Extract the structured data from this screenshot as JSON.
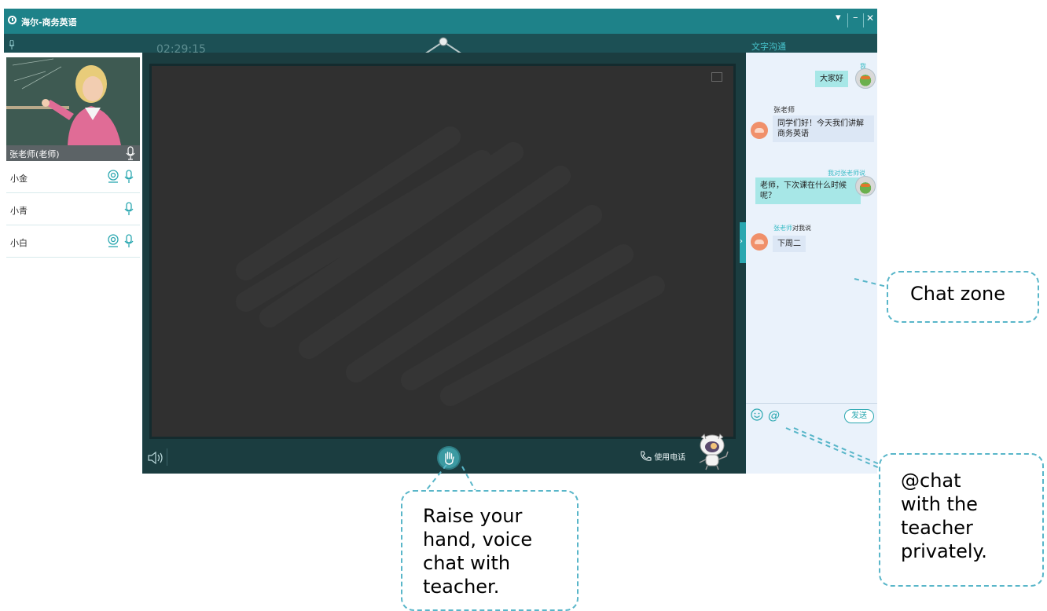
{
  "window": {
    "title": "海尔-商务英语",
    "menu_label": "▾",
    "minimize_label": "–",
    "close_label": "✕"
  },
  "class": {
    "timer": "02:29:15"
  },
  "teacher": {
    "name": "张老师(老师)"
  },
  "students": [
    {
      "name": "小金",
      "camera": true,
      "mic": true
    },
    {
      "name": "小青",
      "camera": false,
      "mic": true
    },
    {
      "name": "小白",
      "camera": true,
      "mic": true
    }
  ],
  "chat": {
    "header": "文字沟通",
    "messages": [
      {
        "sender": "我",
        "text": "大家好",
        "side": "right"
      },
      {
        "sender": "张老师",
        "text": "同学们好！今天我们讲解商务英语",
        "side": "left"
      },
      {
        "sender": "我对张老师说",
        "text": "老师，下次课在什么时候呢？",
        "side": "right"
      },
      {
        "sender_name": "张老师",
        "sender_suffix": "对我说",
        "text": "下周二",
        "side": "left"
      }
    ],
    "send_label": "发送"
  },
  "board": {
    "phone_label": "使用电话"
  },
  "annotations": {
    "chat_zone": "Chat zone",
    "at_chat": [
      "@chat",
      "with the",
      "teacher",
      "privately."
    ],
    "raise_hand": [
      "Raise your",
      "hand, voice",
      "chat with",
      "teacher."
    ]
  },
  "colors": {
    "titlebar": "#1e8289",
    "accent": "#2aa7b0",
    "board": "#2f2f2f",
    "callout_border": "#59b6c9"
  }
}
